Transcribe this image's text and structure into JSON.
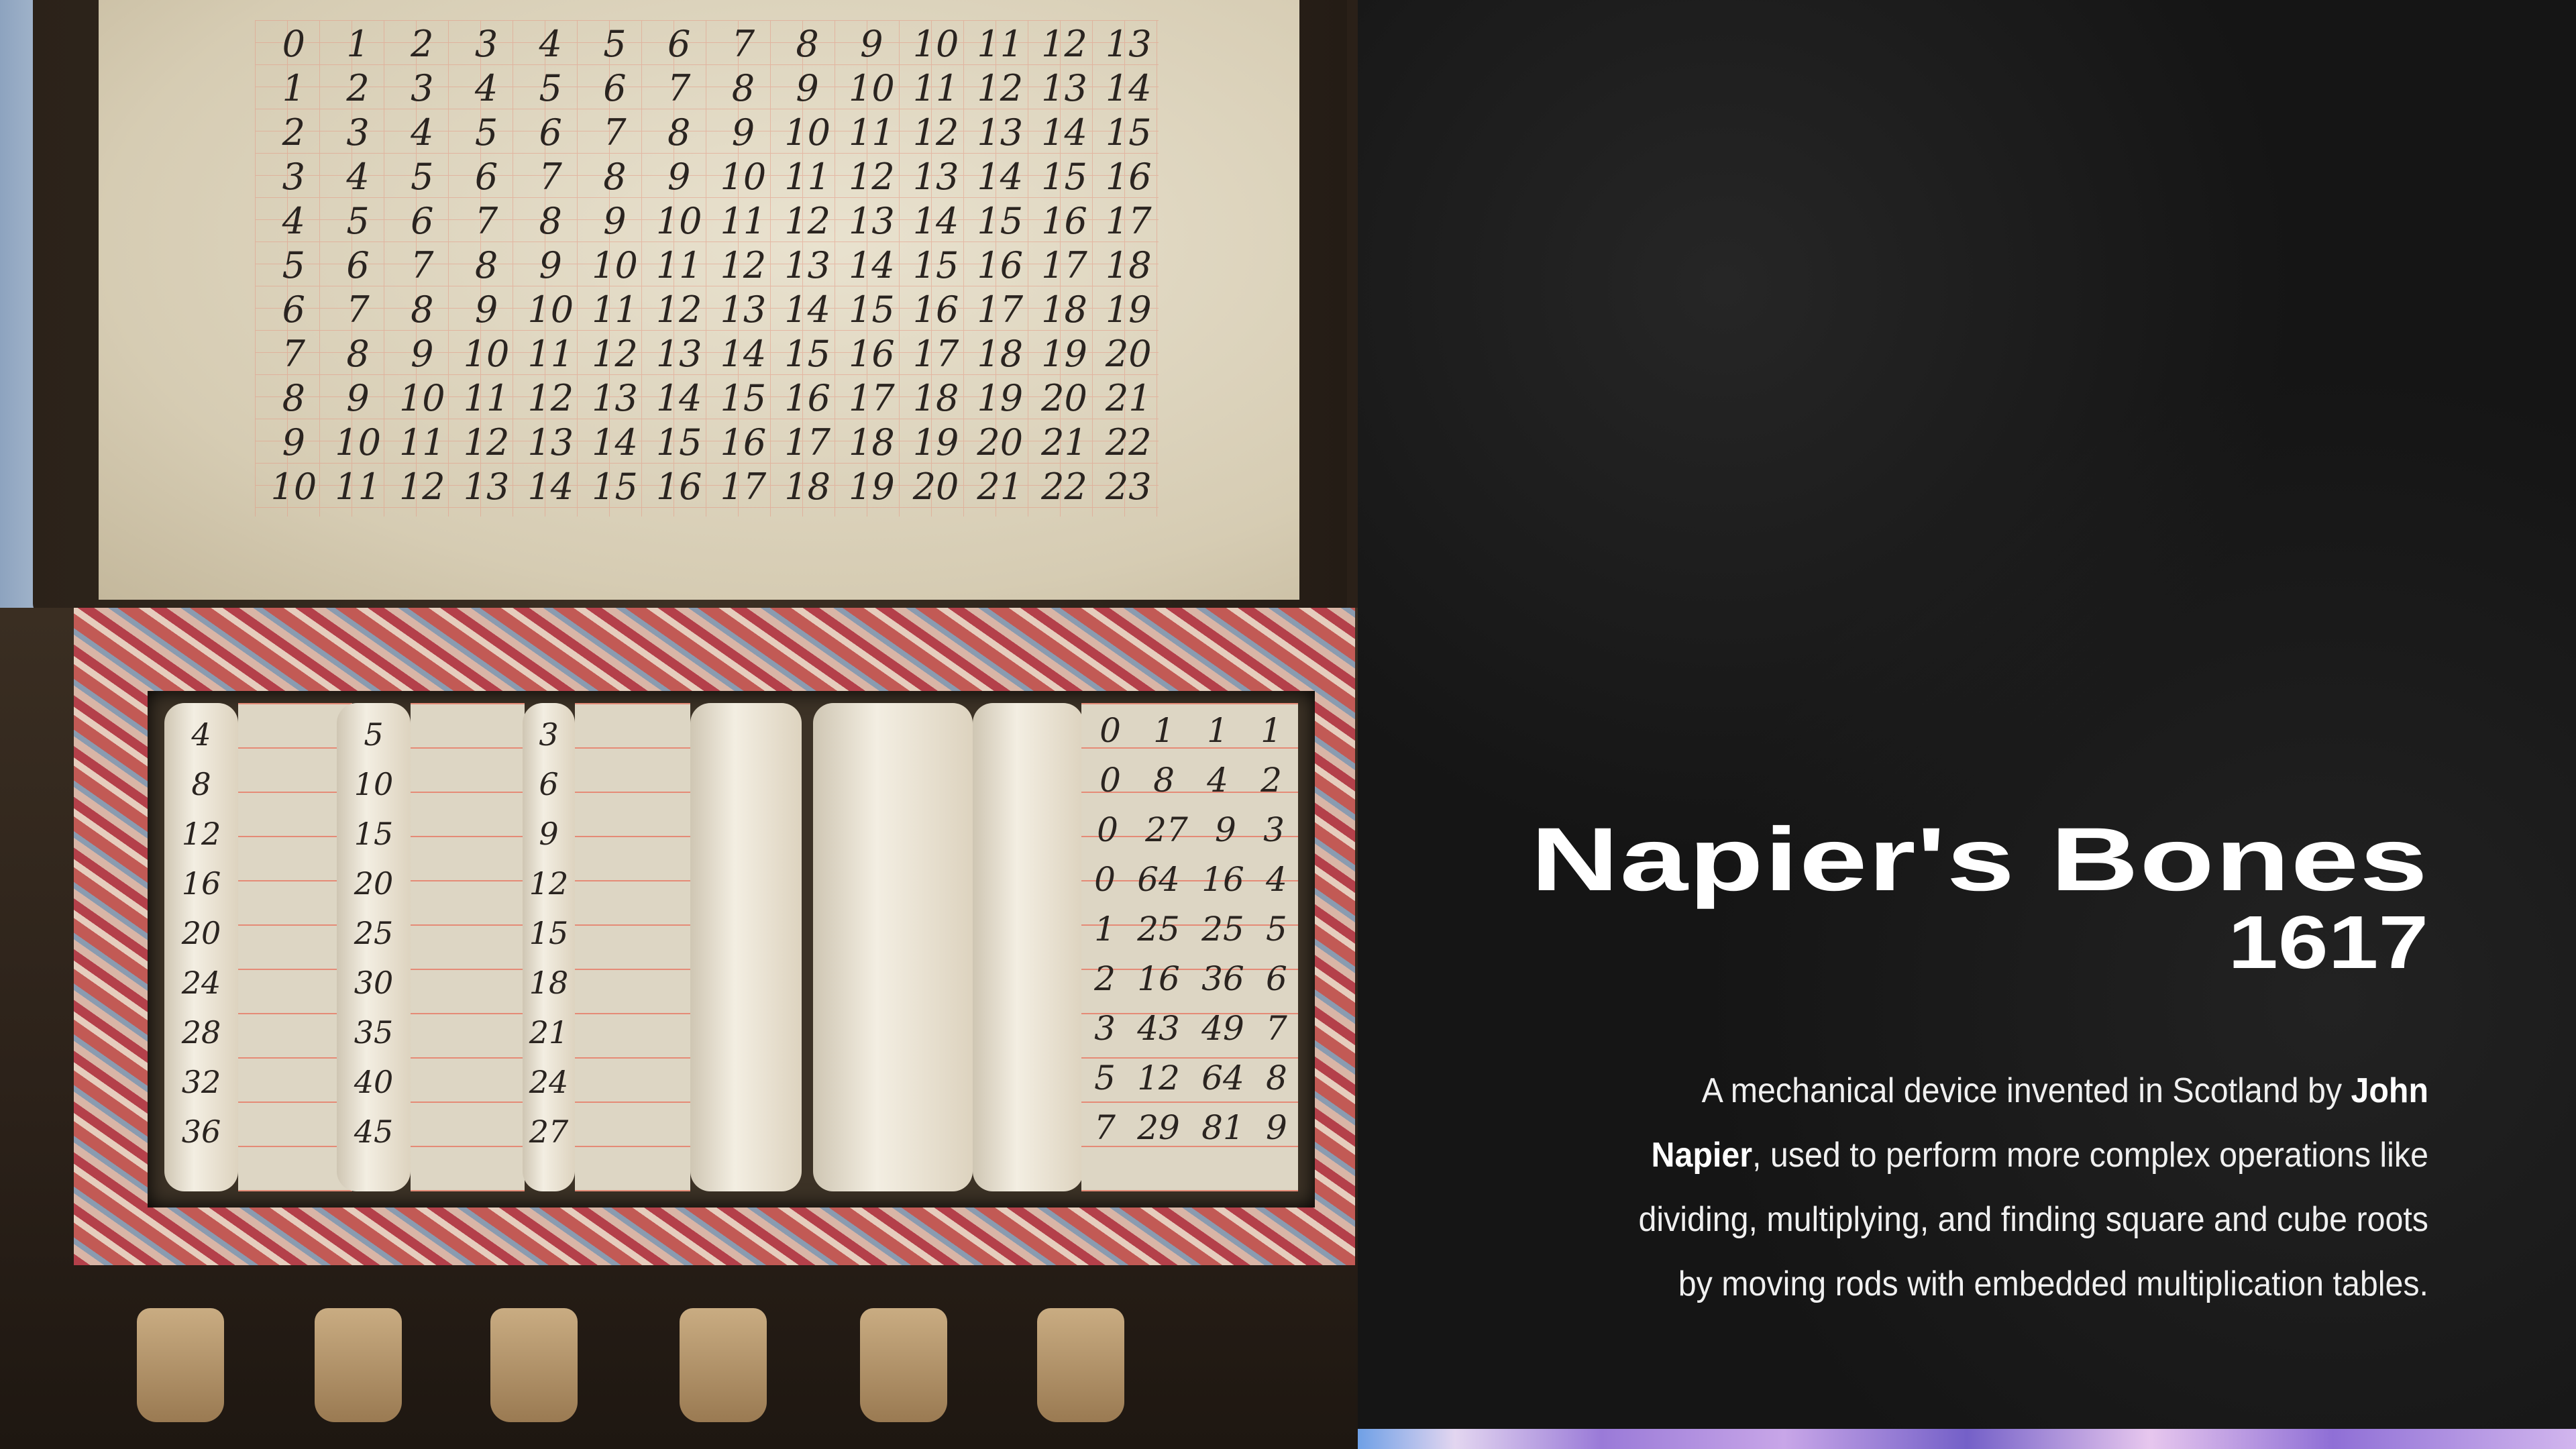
{
  "slide": {
    "title": "Napier's Bones",
    "year": "1617",
    "description_lines": [
      {
        "pre": "A mechanical device invented in Scotland by ",
        "bold": "John",
        "post": ""
      },
      {
        "pre": "",
        "bold": "Napier",
        "post": ", used to perform more complex operations like"
      },
      {
        "pre": "dividing, multiplying, and finding square and cube roots",
        "bold": "",
        "post": ""
      },
      {
        "pre": "by moving rods with embedded multiplication tables.",
        "bold": "",
        "post": ""
      }
    ]
  },
  "photo": {
    "lid_table": [
      [
        "0",
        "1",
        "2",
        "3",
        "4",
        "5",
        "6",
        "7",
        "8",
        "9",
        "10",
        "11",
        "12",
        "13"
      ],
      [
        "1",
        "2",
        "3",
        "4",
        "5",
        "6",
        "7",
        "8",
        "9",
        "10",
        "11",
        "12",
        "13",
        "14"
      ],
      [
        "2",
        "3",
        "4",
        "5",
        "6",
        "7",
        "8",
        "9",
        "10",
        "11",
        "12",
        "13",
        "14",
        "15"
      ],
      [
        "3",
        "4",
        "5",
        "6",
        "7",
        "8",
        "9",
        "10",
        "11",
        "12",
        "13",
        "14",
        "15",
        "16"
      ],
      [
        "4",
        "5",
        "6",
        "7",
        "8",
        "9",
        "10",
        "11",
        "12",
        "13",
        "14",
        "15",
        "16",
        "17"
      ],
      [
        "5",
        "6",
        "7",
        "8",
        "9",
        "10",
        "11",
        "12",
        "13",
        "14",
        "15",
        "16",
        "17",
        "18"
      ],
      [
        "6",
        "7",
        "8",
        "9",
        "10",
        "11",
        "12",
        "13",
        "14",
        "15",
        "16",
        "17",
        "18",
        "19"
      ],
      [
        "7",
        "8",
        "9",
        "10",
        "11",
        "12",
        "13",
        "14",
        "15",
        "16",
        "17",
        "18",
        "19",
        "20"
      ],
      [
        "8",
        "9",
        "10",
        "11",
        "12",
        "13",
        "14",
        "15",
        "16",
        "17",
        "18",
        "19",
        "20",
        "21"
      ],
      [
        "9",
        "10",
        "11",
        "12",
        "13",
        "14",
        "15",
        "16",
        "17",
        "18",
        "19",
        "20",
        "21",
        "22"
      ],
      [
        "10",
        "11",
        "12",
        "13",
        "14",
        "15",
        "16",
        "17",
        "18",
        "19",
        "20",
        "21",
        "22",
        "23"
      ]
    ],
    "rods": [
      [
        "4",
        "8",
        "12",
        "16",
        "20",
        "24",
        "28",
        "32",
        "36"
      ],
      [
        "5",
        "10",
        "15",
        "20",
        "25",
        "30",
        "35",
        "40",
        "45"
      ],
      [
        "3",
        "6",
        "9",
        "12",
        "15",
        "18",
        "21",
        "24",
        "27"
      ]
    ],
    "flat_table": [
      [
        "0",
        "1",
        "1",
        "1"
      ],
      [
        "0",
        "8",
        "4",
        "2"
      ],
      [
        "0",
        "27",
        "9",
        "3"
      ],
      [
        "0",
        "64",
        "16",
        "4"
      ],
      [
        "1",
        "25",
        "25",
        "5"
      ],
      [
        "2",
        "16",
        "36",
        "6"
      ],
      [
        "3",
        "43",
        "49",
        "7"
      ],
      [
        "5",
        "12",
        "64",
        "8"
      ],
      [
        "7",
        "29",
        "81",
        "9"
      ]
    ]
  }
}
